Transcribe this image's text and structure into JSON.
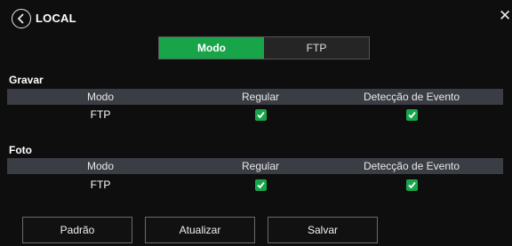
{
  "header": {
    "title": "LOCAL"
  },
  "tabs": [
    {
      "label": "Modo",
      "active": true
    },
    {
      "label": "FTP",
      "active": false
    }
  ],
  "gravar": {
    "label": "Gravar",
    "columns": [
      "Modo",
      "Regular",
      "Detecção de Evento"
    ],
    "rows": [
      {
        "mode": "FTP",
        "regular": true,
        "event_detection": true
      }
    ]
  },
  "foto": {
    "label": "Foto",
    "columns": [
      "Modo",
      "Regular",
      "Detecção de Evento"
    ],
    "rows": [
      {
        "mode": "FTP",
        "regular": true,
        "event_detection": true
      }
    ]
  },
  "buttons": {
    "default_label": "Padrão",
    "refresh_label": "Atualizar",
    "save_label": "Salvar"
  },
  "colors": {
    "accent": "#18a54a",
    "header_row": "#3b3d45",
    "background": "#0e0e0e"
  }
}
